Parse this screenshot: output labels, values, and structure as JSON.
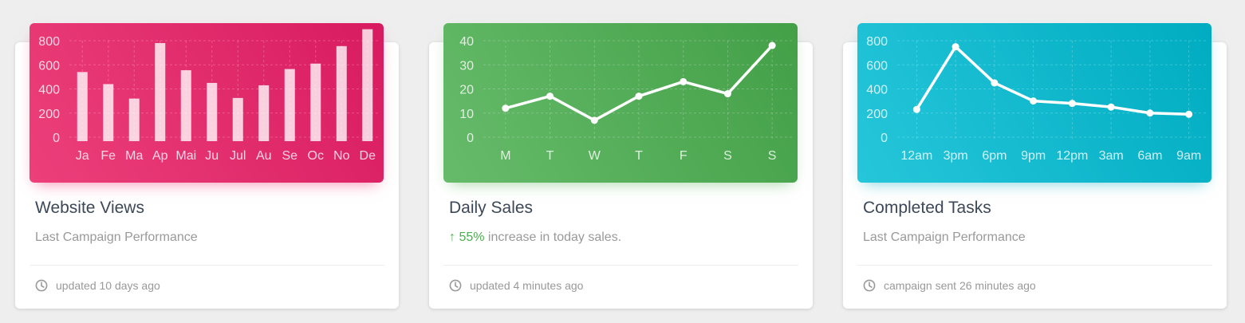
{
  "colors": {
    "pink": "#e91e63",
    "green": "#4caf50",
    "cyan": "#00bcd4",
    "title": "#3c4858",
    "muted": "#999999"
  },
  "cards": [
    {
      "title": "Website Views",
      "category": "Last Campaign Performance",
      "footer": "updated 10 days ago",
      "footer_icon": "clock-icon"
    },
    {
      "title": "Daily Sales",
      "category_arrow": "↑",
      "category_percent": "55%",
      "category_rest": " increase in today sales.",
      "footer": "updated 4 minutes ago",
      "footer_icon": "clock-icon"
    },
    {
      "title": "Completed Tasks",
      "category": "Last Campaign Performance",
      "footer": "campaign sent 26 minutes ago",
      "footer_icon": "clock-icon"
    }
  ],
  "chart_data": [
    {
      "type": "bar",
      "categories": [
        "Ja",
        "Fe",
        "Ma",
        "Ap",
        "Mai",
        "Ju",
        "Jul",
        "Au",
        "Se",
        "Oc",
        "No",
        "De"
      ],
      "values": [
        540,
        440,
        320,
        780,
        555,
        450,
        325,
        430,
        565,
        610,
        755,
        895
      ],
      "ylim": [
        0,
        800
      ],
      "yticks": [
        0,
        200,
        400,
        600,
        800
      ],
      "grid": true
    },
    {
      "type": "line",
      "categories": [
        "M",
        "T",
        "W",
        "T",
        "F",
        "S",
        "S"
      ],
      "values": [
        12,
        17,
        7,
        17,
        23,
        18,
        38
      ],
      "ylim": [
        0,
        40
      ],
      "yticks": [
        0,
        10,
        20,
        30,
        40
      ],
      "grid": true
    },
    {
      "type": "line",
      "categories": [
        "12am",
        "3pm",
        "6pm",
        "9pm",
        "12pm",
        "3am",
        "6am",
        "9am"
      ],
      "values": [
        230,
        750,
        450,
        300,
        280,
        250,
        200,
        190
      ],
      "ylim": [
        0,
        800
      ],
      "yticks": [
        0,
        200,
        400,
        600,
        800
      ],
      "grid": true
    }
  ]
}
